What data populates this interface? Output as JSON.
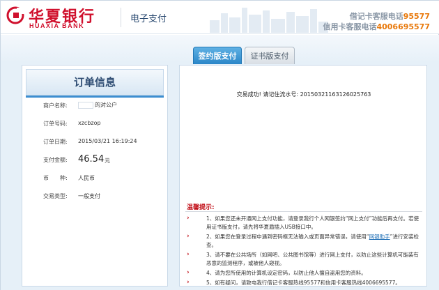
{
  "header": {
    "bank_name_cn": "华夏银行",
    "bank_name_en": "HUAXIA BANK",
    "section_title": "电子支付",
    "debit_hotline_label": "借记卡客服电话",
    "debit_hotline_number": "95577",
    "credit_hotline_label": "信用卡客服电话",
    "credit_hotline_number": "4006695577",
    "logo_icon": "huaxia-bank-logo-icon"
  },
  "tabs": [
    {
      "label": "签约版支付",
      "active": true
    },
    {
      "label": "证书版支付",
      "active": false
    }
  ],
  "order": {
    "title": "订单信息",
    "rows": {
      "merchant_label": "商户名称:",
      "merchant_value": "的对公户",
      "order_no_label": "订单号码:",
      "order_no_value": "xzcbzop",
      "order_date_label": "订单日期:",
      "order_date_value": "2015/03/21 16:19:24",
      "amount_label": "支付金额:",
      "amount_value": "46.54",
      "amount_unit": "元",
      "currency_label": "币　　种:",
      "currency_value": "人民币",
      "txn_type_label": "交易类型:",
      "txn_type_value": "一般支付"
    }
  },
  "result": {
    "message": "交易成功! 请记住流水号: 20150321163126025763"
  },
  "tips": {
    "title": "温馨提示:",
    "items": [
      {
        "text": "1、如果您还未开通网上支付功能，请登录我行个人网银签约“网上支付”功能后再支付。若使用证书版支付，请先将华夏盾插入USB接口中。"
      },
      {
        "text_before": "2、如果您在登录过程中遇到密码框无法输入或页面异常错误，请使用“",
        "link": "网银助手",
        "text_after": "”进行安装检查。"
      },
      {
        "text": "3、请不要在公共场所（如网吧、公共图书馆等）进行网上支付，以防止这些计算机可能装有恶意的监测程序，或被他人窥视。"
      },
      {
        "text": "4、请为您所使用的计算机设定密码，以防止他人擅自盗用您的资料。"
      },
      {
        "text": "5、如有疑问，请致电我行借记卡客服热线95577和信用卡客服热线4006695577。"
      }
    ]
  },
  "colors": {
    "brand_red": "#d0102d",
    "hotline_orange": "#e8780a",
    "tab_blue": "#2a86c8",
    "band_blue": "#e6f0f8"
  }
}
